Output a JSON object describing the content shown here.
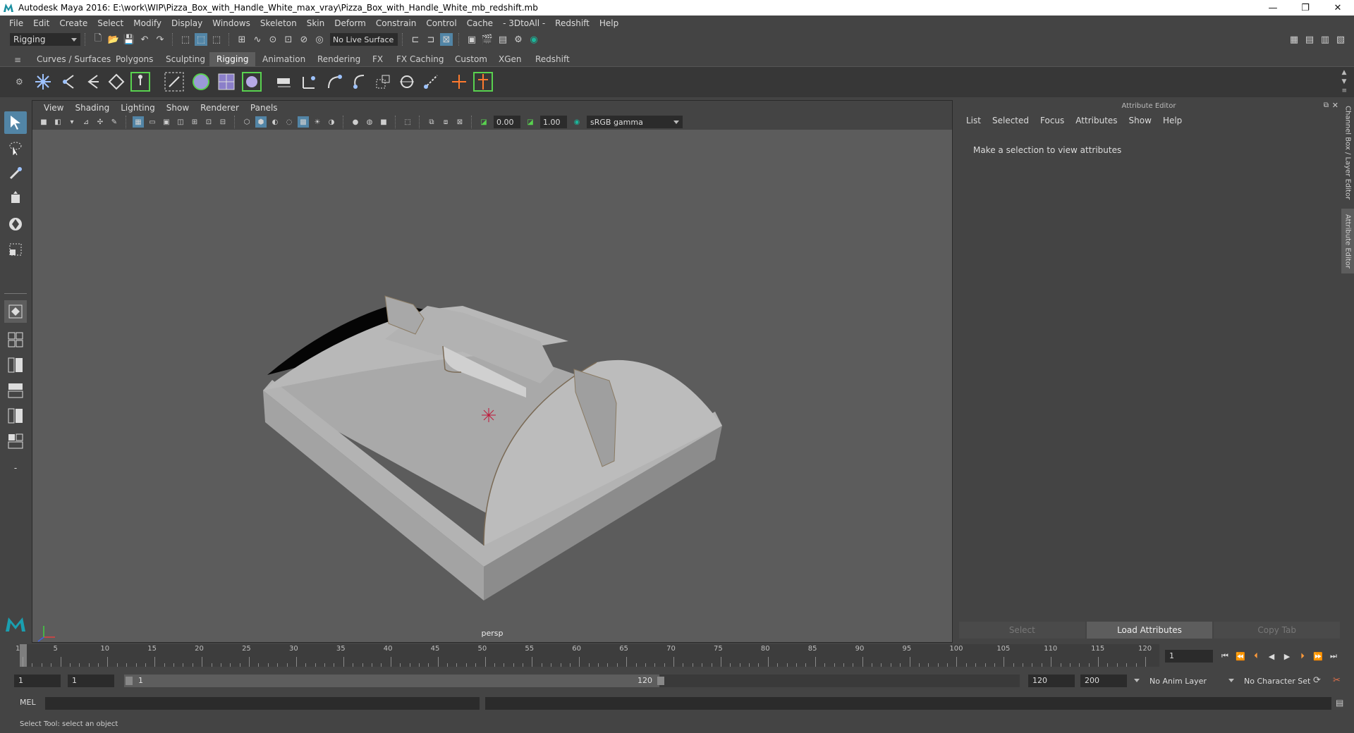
{
  "window": {
    "title": "Autodesk Maya 2016: E:\\work\\WIP\\Pizza_Box_with_Handle_White_max_vray\\Pizza_Box_with_Handle_White_mb_redshift.mb",
    "minimize": "—",
    "restore": "❐",
    "close": "✕"
  },
  "menubar": [
    "File",
    "Edit",
    "Create",
    "Select",
    "Modify",
    "Display",
    "Windows",
    "Skeleton",
    "Skin",
    "Deform",
    "Constrain",
    "Control",
    "Cache",
    "- 3DtoAll -",
    "Redshift",
    "Help"
  ],
  "statusline": {
    "mode": "Rigging",
    "live_surface": "No Live Surface"
  },
  "shelf_tabs": [
    "Curves / Surfaces",
    "Polygons",
    "Sculpting",
    "Rigging",
    "Animation",
    "Rendering",
    "FX",
    "FX Caching",
    "Custom",
    "XGen",
    "Redshift"
  ],
  "active_shelf_tab": "Rigging",
  "panel": {
    "menus": [
      "View",
      "Shading",
      "Lighting",
      "Show",
      "Renderer",
      "Panels"
    ],
    "exposure": "0.00",
    "gamma": "1.00",
    "color_space": "sRGB gamma",
    "camera_label": "persp"
  },
  "attribute_editor": {
    "title": "Attribute Editor",
    "menus": [
      "List",
      "Selected",
      "Focus",
      "Attributes",
      "Show",
      "Help"
    ],
    "message": "Make a selection to view attributes",
    "buttons": [
      "Select",
      "Load Attributes",
      "Copy Tab"
    ]
  },
  "side_tabs": [
    "Channel Box / Layer Editor",
    "Attribute Editor"
  ],
  "timeline": {
    "ticks": [
      "1",
      "5",
      "10",
      "15",
      "20",
      "25",
      "30",
      "35",
      "40",
      "45",
      "50",
      "55",
      "60",
      "65",
      "70",
      "75",
      "80",
      "85",
      "90",
      "95",
      "100",
      "105",
      "110",
      "115",
      "120"
    ],
    "current_frame": "1"
  },
  "range": {
    "start_field": "1",
    "playback_start": "1",
    "slider_start": "1",
    "slider_end": "120",
    "playback_end": "120",
    "end_field": "200",
    "anim_layer": "No Anim Layer",
    "character_set": "No Character Set"
  },
  "command_line": {
    "label": "MEL"
  },
  "help_line": "Select Tool: select an object",
  "colors": {
    "accent": "#5285a6",
    "viewport_bg": "#5c5c5c",
    "ui_bg": "#444444"
  }
}
